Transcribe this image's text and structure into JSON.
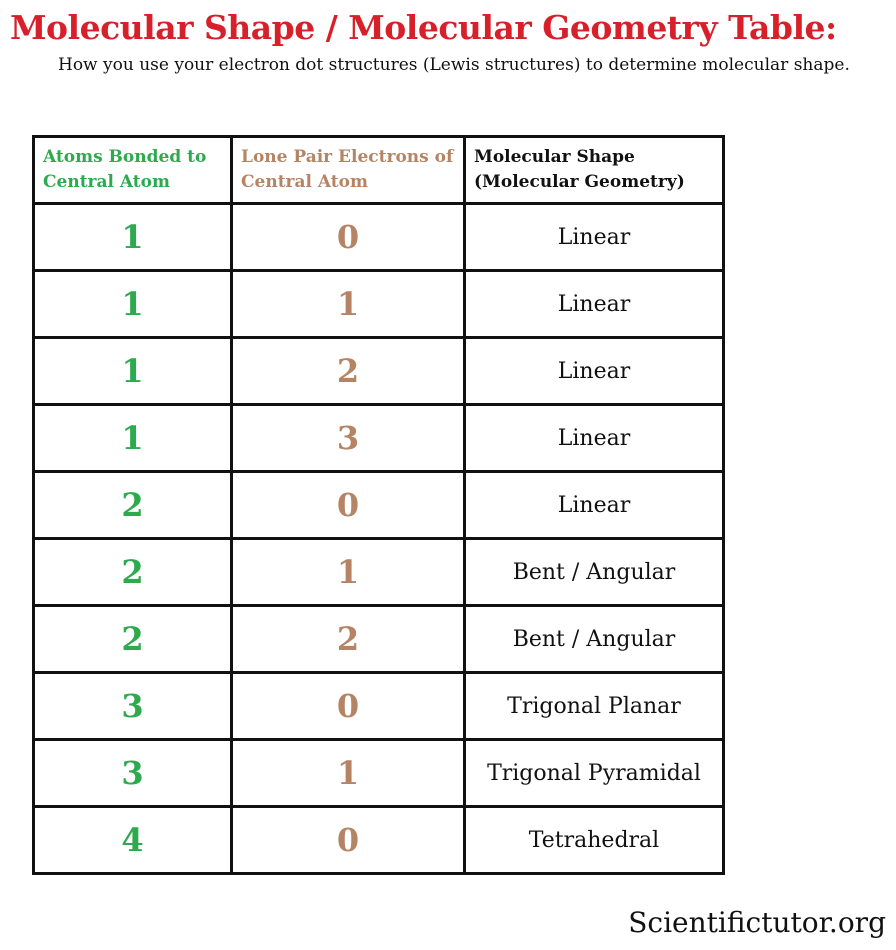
{
  "title": "Molecular Shape / Molecular Geometry Table:",
  "subtitle": "How you use your electron dot structures (Lewis structures) to determine molecular shape.",
  "colors": {
    "title": "#d7202a",
    "atoms": "#2eaa4e",
    "lone_pairs": "#b58465",
    "text": "#111111"
  },
  "table": {
    "headers": [
      "Atoms Bonded to Central Atom",
      "Lone Pair Electrons of Central Atom",
      "Molecular Shape (Molecular Geometry)"
    ],
    "rows": [
      {
        "atoms": "1",
        "lone_pairs": "0",
        "shape": "Linear"
      },
      {
        "atoms": "1",
        "lone_pairs": "1",
        "shape": "Linear"
      },
      {
        "atoms": "1",
        "lone_pairs": "2",
        "shape": "Linear"
      },
      {
        "atoms": "1",
        "lone_pairs": "3",
        "shape": "Linear"
      },
      {
        "atoms": "2",
        "lone_pairs": "0",
        "shape": "Linear"
      },
      {
        "atoms": "2",
        "lone_pairs": "1",
        "shape": "Bent / Angular"
      },
      {
        "atoms": "2",
        "lone_pairs": "2",
        "shape": "Bent / Angular"
      },
      {
        "atoms": "3",
        "lone_pairs": "0",
        "shape": "Trigonal Planar"
      },
      {
        "atoms": "3",
        "lone_pairs": "1",
        "shape": "Trigonal Pyramidal"
      },
      {
        "atoms": "4",
        "lone_pairs": "0",
        "shape": "Tetrahedral"
      }
    ]
  },
  "footer": "Scientifictutor.org"
}
